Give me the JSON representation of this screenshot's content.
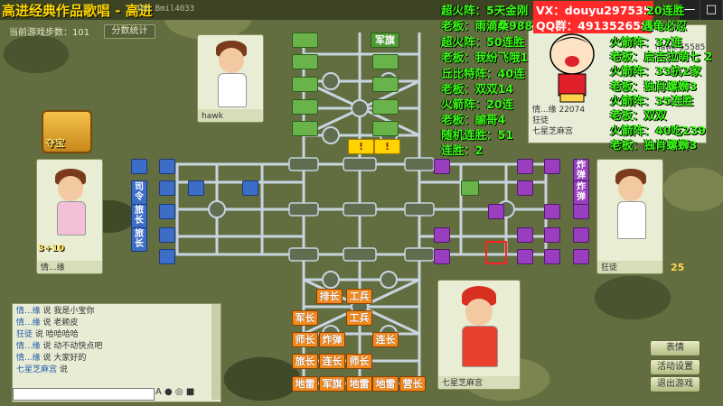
{
  "window": {
    "title": "高进经典作品歌唱 - 高进",
    "title_suffix": "408 Bmil4033",
    "controls": [
      "—",
      "□"
    ]
  },
  "game": {
    "step_label": "当前游戏步数：101",
    "stats_button": "分数统计",
    "treasure_label": "夺宝",
    "level_badge": "3+10",
    "score": "25"
  },
  "players": {
    "top": {
      "name": "hawk"
    },
    "left": {
      "name": "情...缘"
    },
    "right": {
      "name": "狂徒"
    },
    "bottom": {
      "name": "七星芝麻宫"
    }
  },
  "board": {
    "top_pieces": [
      {
        "text": "",
        "color": "green"
      },
      {
        "text": "军旗",
        "color": "green"
      },
      {
        "text": "",
        "color": "green"
      },
      {
        "text": "",
        "color": "green"
      },
      {
        "text": "",
        "color": "green"
      },
      {
        "text": "",
        "color": "green"
      },
      {
        "text": "",
        "color": "green"
      },
      {
        "text": "",
        "color": "green"
      },
      {
        "text": "",
        "color": "green"
      },
      {
        "text": "",
        "color": "green"
      },
      {
        "text": "!",
        "color": "yellow"
      },
      {
        "text": "!",
        "color": "yellow"
      }
    ],
    "bottom_pieces": [
      {
        "text": "排长",
        "color": "orange"
      },
      {
        "text": "工兵",
        "color": "orange"
      },
      {
        "text": "军长",
        "color": "orange"
      },
      {
        "text": "工兵",
        "color": "orange"
      },
      {
        "text": "师长",
        "color": "orange"
      },
      {
        "text": "炸弹",
        "color": "orange"
      },
      {
        "text": "连长",
        "color": "orange"
      },
      {
        "text": "旅长",
        "color": "orange"
      },
      {
        "text": "连长",
        "color": "orange"
      },
      {
        "text": "师长",
        "color": "orange"
      },
      {
        "text": "地雷",
        "color": "orange"
      },
      {
        "text": "军旗",
        "color": "orange"
      },
      {
        "text": "地雷",
        "color": "orange"
      },
      {
        "text": "地雷",
        "color": "orange"
      },
      {
        "text": "营长",
        "color": "orange"
      }
    ],
    "left_pieces": [
      {
        "text": "司令",
        "color": "blue"
      },
      {
        "text": "旅长",
        "color": "blue"
      },
      {
        "text": "旅长",
        "color": "blue"
      }
    ],
    "right_pieces": [
      {
        "text": "炸弹",
        "color": "purple"
      },
      {
        "text": "炸弹",
        "color": "purple"
      }
    ]
  },
  "chat": {
    "lines": [
      {
        "user": "情...缘",
        "text": "说 我是小宝你"
      },
      {
        "user": "情...缘",
        "text": "说 老赖皮"
      },
      {
        "user": "狂徒",
        "text": "说 哈哈哈哈"
      },
      {
        "user": "情...缘",
        "text": "说 动不动快点吧"
      },
      {
        "user": "情...缘",
        "text": "说 大家好的"
      },
      {
        "user": "七星芝麻宫",
        "text": "说"
      }
    ],
    "input_value": "",
    "icons": "A ● ◎ ■"
  },
  "side_buttons": {
    "expression": "表情",
    "settings": "活动设置",
    "quit": "退出游戏"
  },
  "overlay_left": [
    "超火阵：5天金刚",
    "老板：雨滴桑988",
    "超火阵：50连胜",
    "老板：我纷飞哦1",
    "丘比特阵：40连",
    "老板：双双14",
    "火箭阵：20连",
    "老板：諭哥4",
    "随机连胜：51",
    "连胜：2"
  ],
  "overlay_right": [
    "火箭阵：37连",
    "老板：启吉拉萌七 2",
    "火箭阵：33抗2家",
    "老板：独肖螺蛳3",
    "火箭阵：35连胜",
    "老板：双双",
    "火箭阵：40吃239",
    "老板：独肖螺蛳3"
  ],
  "overlay_top": {
    "vx": "VX：douyu297535",
    "qq": "QQ群：491352658",
    "tail_a": "20连胜",
    "tail_b": "遇龟必忍"
  },
  "user_panel": {
    "rows": [
      {
        "name": "情...缘",
        "value": "22074"
      },
      {
        "name": "狂徒",
        "value": ""
      },
      {
        "name": "hawk",
        "value": "55585"
      },
      {
        "name": "七星芝麻宫",
        "value": ""
      }
    ]
  },
  "colors": {
    "accent_green": "#39ff14",
    "accent_red": "#ff2a2a",
    "title_yellow": "#ffd800"
  }
}
